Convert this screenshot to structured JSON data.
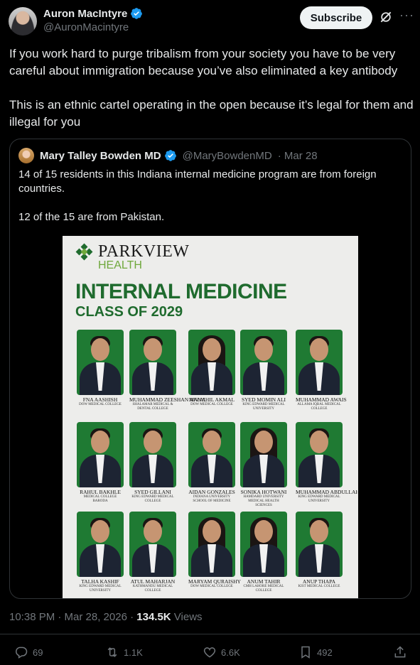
{
  "author": {
    "name": "Auron MacIntyre",
    "handle": "@AuronMacintyre",
    "subscribe_label": "Subscribe",
    "icons": [
      "verified-icon",
      "grok-icon",
      "more-icon"
    ]
  },
  "tweet": {
    "paragraphs": [
      "If you work hard to purge tribalism from your society you have to be very careful about immigration because you’ve also eliminated a key antibody",
      "This is an ethnic cartel operating in the open because it’s legal for them and illegal for you"
    ]
  },
  "quote": {
    "name": "Mary Talley Bowden MD",
    "handle": "@MaryBowdenMD",
    "date": "· Mar 28",
    "paragraphs": [
      "14 of 15 residents in this Indiana internal medicine program are from foreign countries.",
      "12 of the 15 are from Pakistan."
    ],
    "image": {
      "brand1": "PARKVIEW",
      "brand2": "HEALTH",
      "title": "INTERNAL MEDICINE",
      "subtitle": "CLASS OF 2029",
      "residents": [
        {
          "name": "FNA AASHISH",
          "school": "DOW MEDICAL COLLEGE",
          "f": false
        },
        {
          "name": "MUHAMMAD ZEESHAN AFZAL",
          "school": "SHALAMAR MEDICAL & DENTAL COLLEGE",
          "f": false
        },
        {
          "name": "MANAHIL AKMAL",
          "school": "DOW MEDICAL COLLEGE",
          "f": true
        },
        {
          "name": "SYED MOMIN ALI",
          "school": "KING EDWARD MEDICAL UNIVERSITY",
          "f": false
        },
        {
          "name": "MUHAMMAD AWAIS",
          "school": "ALLAMA IQBAL MEDICAL COLLEGE",
          "f": false
        },
        {
          "name": "RAHUL BAKHLE",
          "school": "MEDICAL COLLEGE BARODA",
          "f": false
        },
        {
          "name": "SYED GILLANI",
          "school": "KING EDWARD MEDICAL COLLEGE",
          "f": false
        },
        {
          "name": "AIDAN GONZALES",
          "school": "INDIANA UNIVERSITY SCHOOL OF MEDICINE",
          "f": false
        },
        {
          "name": "SONIKA HOTWANI",
          "school": "HAMDARD UNIVERSITY MEDICAL HEALTH SCIENCES",
          "f": true
        },
        {
          "name": "MUHAMMAD ABDULLAH ILYAS",
          "school": "KING EDWARD MEDICAL UNIVERSITY",
          "f": false
        },
        {
          "name": "TALHA KASHIF",
          "school": "KING EDWARD MEDICAL UNIVERSITY",
          "f": false
        },
        {
          "name": "ATUL MAHARJAN",
          "school": "KATHMANDU MEDICAL COLLEGE",
          "f": false
        },
        {
          "name": "MARYAM QURAISHY",
          "school": "DOW MEDICAL COLLEGE",
          "f": true
        },
        {
          "name": "ANUM TAHIR",
          "school": "CMH LAHORE MEDICAL COLLEGE",
          "f": true
        },
        {
          "name": "ANUP THAPA",
          "school": "KIST MEDICAL COLLEGE",
          "f": false
        }
      ]
    }
  },
  "meta": {
    "time": "10:38 PM · Mar 28, 2026 · ",
    "views_count": "134.5K",
    "views_label": " Views"
  },
  "actions": {
    "replies": "69",
    "reposts": "1.1K",
    "likes": "6.6K",
    "bookmarks": "492"
  },
  "colors": {
    "background": "#000000",
    "text": "#e7e9ea",
    "muted": "#71767b",
    "verified": "#1d9bf0",
    "poster_green": "#1f6b2e"
  }
}
